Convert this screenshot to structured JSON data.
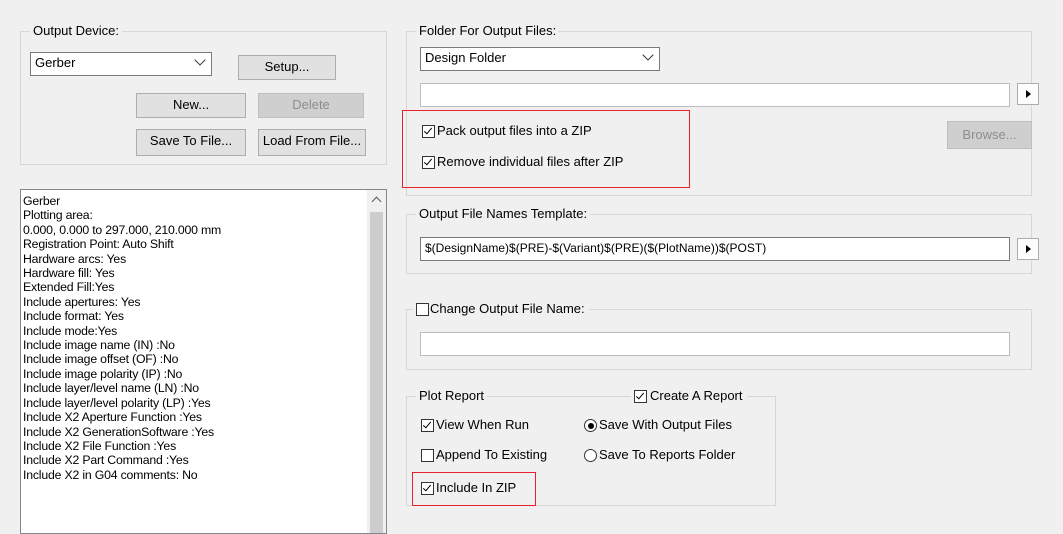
{
  "output_device": {
    "legend": "Output Device:",
    "device_value": "Gerber",
    "setup_label": "Setup...",
    "new_label": "New...",
    "delete_label": "Delete",
    "save_to_file_label": "Save To File...",
    "load_from_file_label": "Load From File..."
  },
  "device_info": {
    "lines": [
      "Gerber",
      "Plotting area:",
      "0.000, 0.000 to 297.000, 210.000 mm",
      "Registration Point: Auto Shift",
      "Hardware arcs: Yes",
      "Hardware fill: Yes",
      "Extended Fill:Yes",
      "Include apertures: Yes",
      "Include format: Yes",
      "Include mode:Yes",
      "Include image name (IN) :No",
      "Include image offset (OF) :No",
      "Include image polarity (IP) :No",
      "Include layer/level name (LN) :No",
      "Include layer/level polarity (LP) :Yes",
      "Include X2 Aperture Function :Yes",
      "Include X2 GenerationSoftware :Yes",
      "Include X2 File Function :Yes",
      "Include X2 Part Command :Yes",
      "Include X2 in G04 comments: No"
    ]
  },
  "output_folder": {
    "legend": "Folder For Output Files:",
    "folder_value": "Design Folder",
    "path_value": "",
    "pack_zip_label": "Pack output files into a ZIP",
    "pack_zip_checked": true,
    "remove_files_label": "Remove individual files after ZIP",
    "remove_files_checked": true,
    "browse_label": "Browse..."
  },
  "file_names_template": {
    "legend": "Output File Names Template:",
    "value": "$(DesignName)$(PRE)-$(Variant)$(PRE)($(PlotName))$(POST)"
  },
  "change_file_name": {
    "label": "Change Output File Name:",
    "checked": false,
    "value": ""
  },
  "plot_report": {
    "legend": "Plot Report",
    "create_report_label": "Create A Report",
    "create_report_checked": true,
    "view_when_run_label": "View When Run",
    "view_when_run_checked": true,
    "append_label": "Append To Existing",
    "append_checked": false,
    "include_zip_label": "Include In ZIP",
    "include_zip_checked": true,
    "save_with_output_label": "Save With Output Files",
    "save_to_reports_label": "Save To Reports Folder",
    "selected_save_option": "Save With Output Files"
  },
  "colors": {
    "highlight_border": "#e8222b",
    "window_bg": "#f0f0f0"
  }
}
